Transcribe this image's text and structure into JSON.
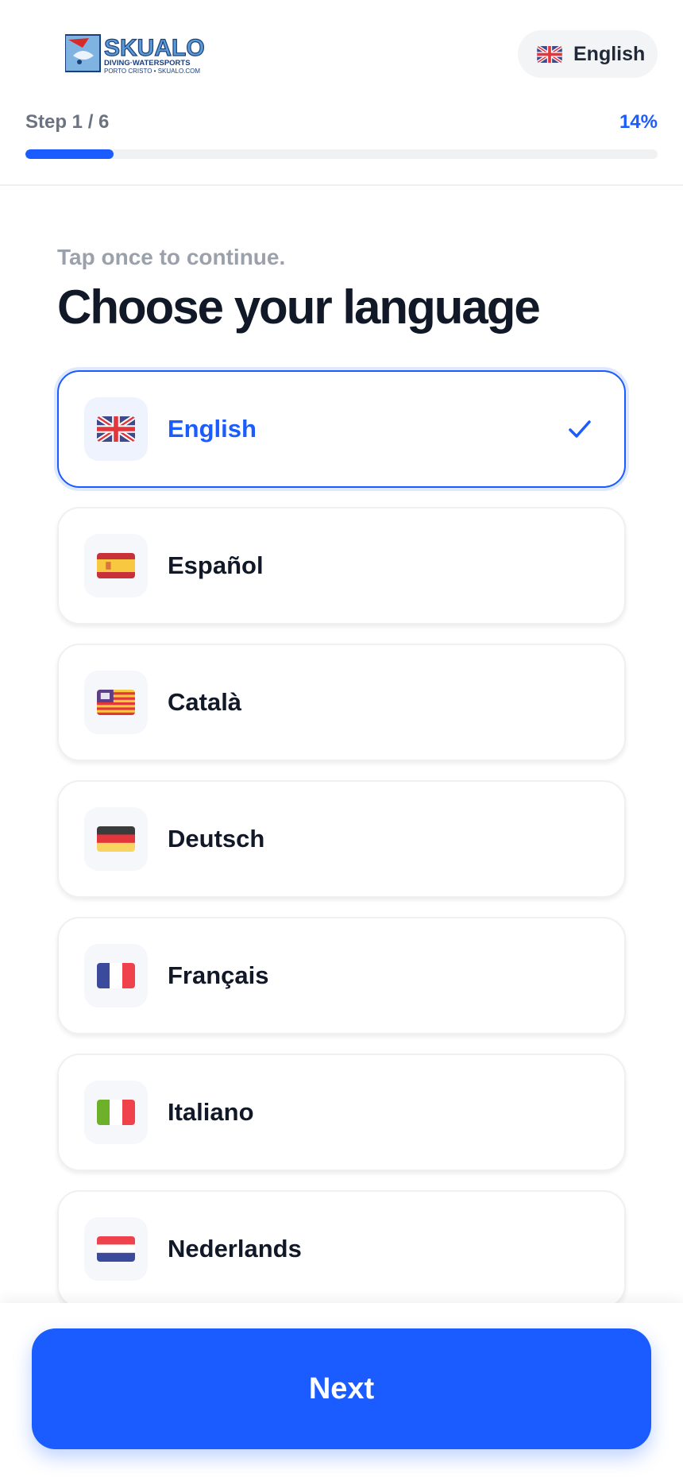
{
  "brand": {
    "logo_wordmark": "SKUALO",
    "logo_tagline": "DIVING·WATERSPORTS",
    "logo_subline": "PORTO CRISTO • SKUALO.COM",
    "accent_color": "#1a5cff"
  },
  "header": {
    "language_pill": {
      "label": "English",
      "flag_icon": "uk-flag-icon"
    }
  },
  "progress": {
    "step_label": "Step 1 / 6",
    "percent_label": "14%",
    "fraction": 0.14
  },
  "main": {
    "subtitle": "Tap once to continue.",
    "title": "Choose your language"
  },
  "languages": [
    {
      "label": "English",
      "flag_icon": "uk-flag-icon",
      "selected": true
    },
    {
      "label": "Español",
      "flag_icon": "spain-flag-icon",
      "selected": false
    },
    {
      "label": "Català",
      "flag_icon": "catalonia-flag-icon",
      "selected": false
    },
    {
      "label": "Deutsch",
      "flag_icon": "germany-flag-icon",
      "selected": false
    },
    {
      "label": "Français",
      "flag_icon": "france-flag-icon",
      "selected": false
    },
    {
      "label": "Italiano",
      "flag_icon": "italy-flag-icon",
      "selected": false
    },
    {
      "label": "Nederlands",
      "flag_icon": "netherlands-flag-icon",
      "selected": false
    }
  ],
  "footer": {
    "next_label": "Next"
  }
}
